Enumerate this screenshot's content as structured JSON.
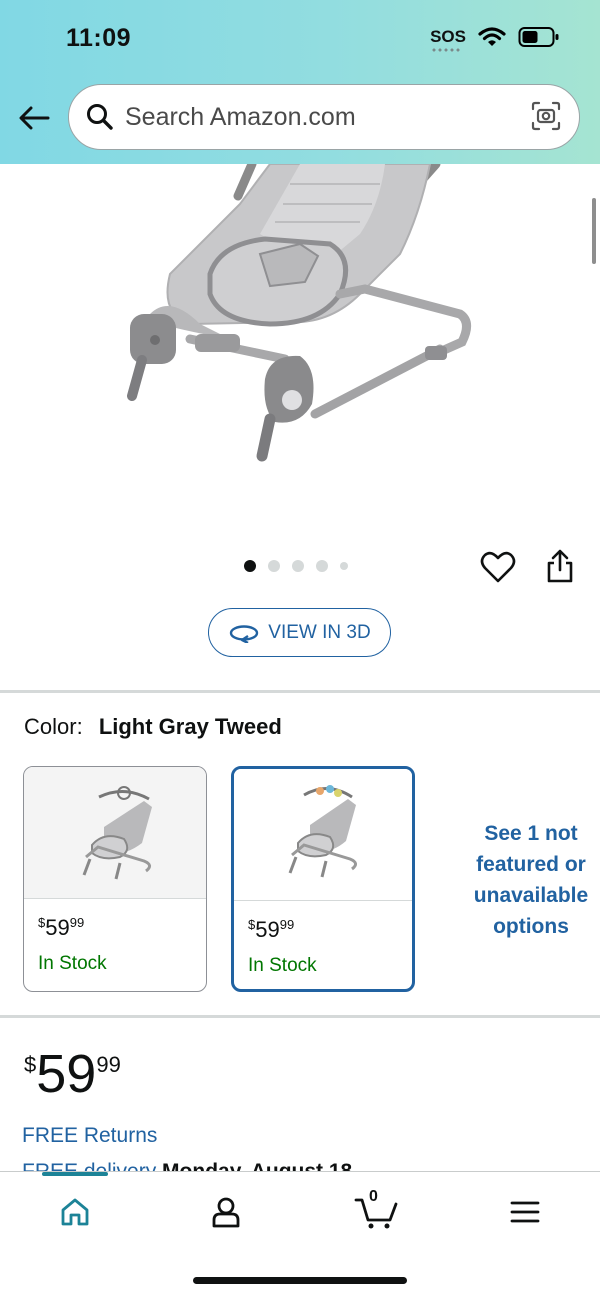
{
  "status_bar": {
    "time": "11:09",
    "sos": "SOS"
  },
  "search": {
    "placeholder": "Search Amazon.com"
  },
  "product_view": {
    "view_3d_label": "VIEW IN 3D",
    "carousel_active_index": 0,
    "carousel_count": 5
  },
  "color": {
    "label": "Color:",
    "selected": "Light Gray Tweed",
    "options": [
      {
        "price_symbol": "$",
        "price_whole": "59",
        "price_fraction": "99",
        "stock": "In Stock"
      },
      {
        "price_symbol": "$",
        "price_whole": "59",
        "price_fraction": "99",
        "stock": "In Stock"
      }
    ],
    "unavailable_link": "See 1 not featured or unavailable options"
  },
  "price": {
    "symbol": "$",
    "whole": "59",
    "fraction": "99"
  },
  "free_returns": "FREE Returns",
  "delivery": {
    "prefix": "FREE delivery",
    "date": "Monday, August 18"
  },
  "nav": {
    "cart_count": "0"
  },
  "colors": {
    "accent_blue": "#2162a1",
    "in_stock_green": "#007600",
    "nav_teal": "#1c8397"
  }
}
